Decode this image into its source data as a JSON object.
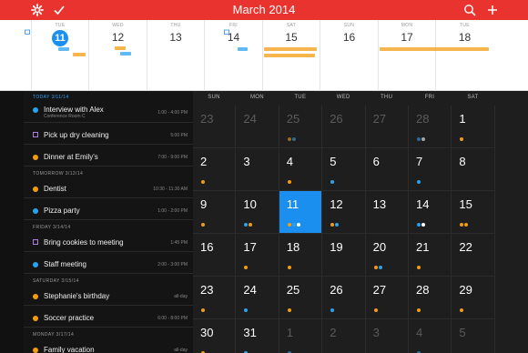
{
  "topbar": {
    "title": "March 2014",
    "settings_icon": "gear-icon",
    "check_icon": "checkmark-icon",
    "search_icon": "search-icon",
    "add_icon": "plus-icon"
  },
  "colors": {
    "accent_red": "#e8332e",
    "today_blue": "#1a8ff0",
    "orange": "#f39c12",
    "blue": "#29a3ef",
    "purple": "#b07fe0"
  },
  "week": {
    "days": [
      {
        "name": "TUE",
        "date": "11",
        "today": true
      },
      {
        "name": "WED",
        "date": "12"
      },
      {
        "name": "THU",
        "date": "13"
      },
      {
        "name": "FRI",
        "date": "14"
      },
      {
        "name": "SAT",
        "date": "15"
      },
      {
        "name": "SUN",
        "date": "16"
      },
      {
        "name": "MON",
        "date": "17"
      },
      {
        "name": "TUE",
        "date": "18"
      }
    ]
  },
  "agenda": {
    "sections": [
      {
        "label": "TODAY 3/11/14",
        "today": true,
        "events": [
          {
            "name": "Interview with Alex",
            "sub": "Conference Room C",
            "time": "1:00 - 4:00 PM",
            "marker": "dot",
            "color": "blue"
          },
          {
            "name": "Pick up dry cleaning",
            "sub": "",
            "time": "5:00 PM",
            "marker": "square",
            "color": "purple"
          },
          {
            "name": "Dinner at Emily's",
            "sub": "",
            "time": "7:00 - 9:00 PM",
            "marker": "dot",
            "color": "orange"
          }
        ]
      },
      {
        "label": "TOMORROW 3/12/14",
        "events": [
          {
            "name": "Dentist",
            "sub": "",
            "time": "10:30 - 11:30 AM",
            "marker": "dot",
            "color": "orange"
          },
          {
            "name": "Pizza party",
            "sub": "",
            "time": "1:00 - 2:00 PM",
            "marker": "dot",
            "color": "blue"
          }
        ]
      },
      {
        "label": "FRIDAY 3/14/14",
        "events": [
          {
            "name": "Bring cookies to meeting",
            "sub": "",
            "time": "1:45 PM",
            "marker": "square",
            "color": "purple"
          },
          {
            "name": "Staff meeting",
            "sub": "",
            "time": "2:00 - 3:00 PM",
            "marker": "dot",
            "color": "blue"
          }
        ]
      },
      {
        "label": "SATURDAY 3/15/14",
        "events": [
          {
            "name": "Stephanie's birthday",
            "sub": "",
            "time": "all-day",
            "marker": "dot",
            "color": "orange"
          },
          {
            "name": "Soccer practice",
            "sub": "",
            "time": "6:00 - 8:00 PM",
            "marker": "dot",
            "color": "orange"
          }
        ]
      },
      {
        "label": "MONDAY 3/17/14",
        "events": [
          {
            "name": "Family vacation",
            "sub": "",
            "time": "all-day",
            "marker": "dot",
            "color": "orange"
          }
        ]
      }
    ]
  },
  "month": {
    "headers": [
      "SUN",
      "MON",
      "TUE",
      "WED",
      "THU",
      "FRI",
      "SAT"
    ],
    "weeks": [
      [
        {
          "d": "23",
          "dim": true
        },
        {
          "d": "24",
          "dim": true
        },
        {
          "d": "25",
          "dim": true,
          "dots": [
            "orange",
            "blue"
          ]
        },
        {
          "d": "26",
          "dim": true
        },
        {
          "d": "27",
          "dim": true
        },
        {
          "d": "28",
          "dim": true,
          "dots": [
            "blue",
            "white"
          ]
        },
        {
          "d": "1",
          "dots": [
            "orange"
          ]
        }
      ],
      [
        {
          "d": "2",
          "dots": [
            "orange"
          ]
        },
        {
          "d": "3"
        },
        {
          "d": "4",
          "dots": [
            "orange"
          ]
        },
        {
          "d": "5",
          "dots": [
            "blue"
          ]
        },
        {
          "d": "6"
        },
        {
          "d": "7",
          "dots": [
            "blue"
          ]
        },
        {
          "d": "8"
        }
      ],
      [
        {
          "d": "9",
          "dots": [
            "orange"
          ]
        },
        {
          "d": "10",
          "dots": [
            "blue",
            "orange"
          ]
        },
        {
          "d": "11",
          "sel": true,
          "dots": [
            "orange",
            "blue",
            "white"
          ]
        },
        {
          "d": "12",
          "dots": [
            "orange",
            "blue"
          ]
        },
        {
          "d": "13"
        },
        {
          "d": "14",
          "dots": [
            "blue",
            "white"
          ]
        },
        {
          "d": "15",
          "dots": [
            "orange",
            "orange"
          ]
        }
      ],
      [
        {
          "d": "16"
        },
        {
          "d": "17",
          "dots": [
            "orange"
          ]
        },
        {
          "d": "18",
          "dots": [
            "orange"
          ]
        },
        {
          "d": "19"
        },
        {
          "d": "20",
          "dots": [
            "orange",
            "blue"
          ]
        },
        {
          "d": "21",
          "dots": [
            "orange"
          ]
        },
        {
          "d": "22"
        }
      ],
      [
        {
          "d": "23",
          "dots": [
            "orange"
          ]
        },
        {
          "d": "24",
          "dots": [
            "blue"
          ]
        },
        {
          "d": "25",
          "dots": [
            "orange"
          ]
        },
        {
          "d": "26",
          "dots": [
            "blue"
          ]
        },
        {
          "d": "27",
          "dots": [
            "orange"
          ]
        },
        {
          "d": "28",
          "dots": [
            "orange"
          ]
        },
        {
          "d": "29",
          "dots": [
            "orange"
          ]
        }
      ],
      [
        {
          "d": "30",
          "dots": [
            "orange"
          ]
        },
        {
          "d": "31",
          "dots": [
            "blue"
          ]
        },
        {
          "d": "1",
          "dim": true,
          "dots": [
            "blue"
          ]
        },
        {
          "d": "2",
          "dim": true
        },
        {
          "d": "3",
          "dim": true
        },
        {
          "d": "4",
          "dim": true,
          "dots": [
            "blue"
          ]
        },
        {
          "d": "5",
          "dim": true
        }
      ]
    ]
  }
}
